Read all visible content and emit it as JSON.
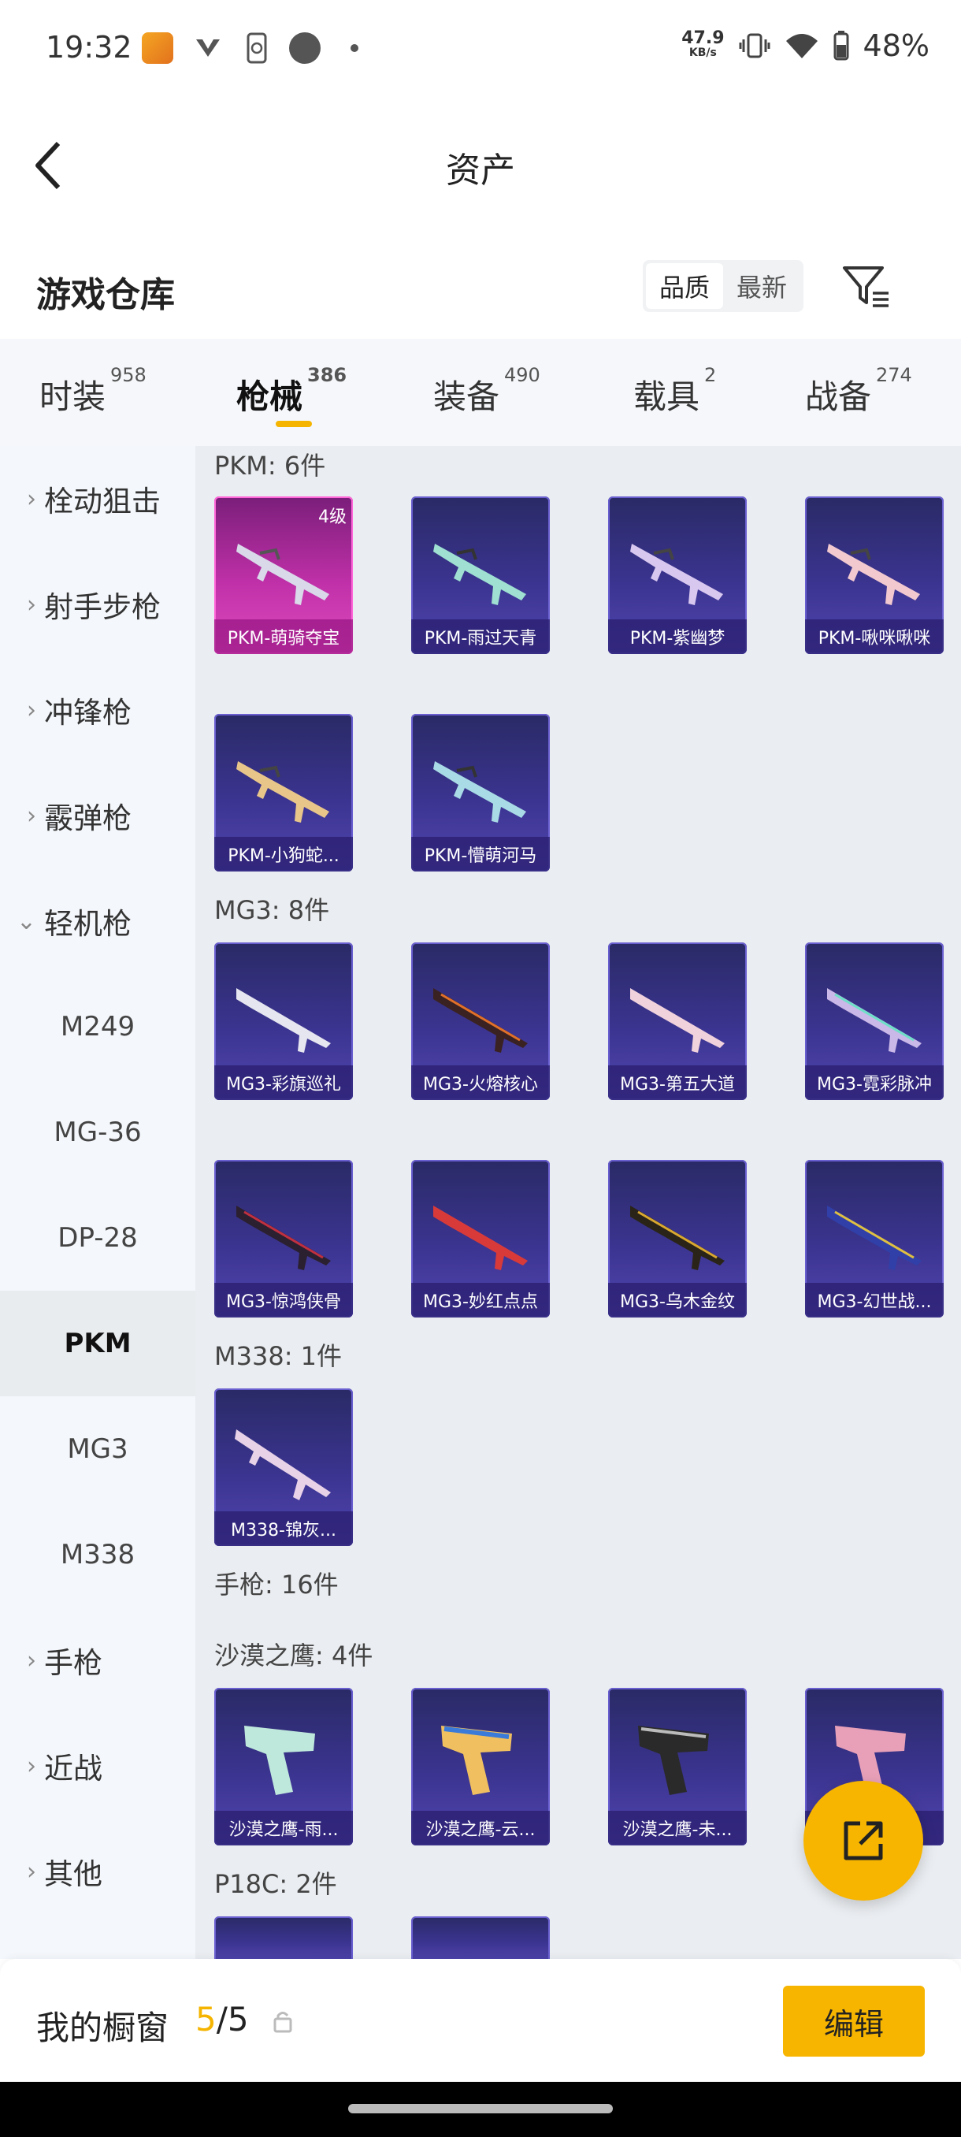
{
  "status": {
    "time": "19:32",
    "speed_value": "47.9",
    "speed_unit": "KB/s",
    "battery": "48%"
  },
  "header": {
    "title": "资产"
  },
  "section": {
    "title": "游戏仓库",
    "sort_options": [
      "品质",
      "最新"
    ],
    "sort_active": "品质"
  },
  "tabs": [
    {
      "label": "时装",
      "count": "958"
    },
    {
      "label": "枪械",
      "count": "386"
    },
    {
      "label": "装备",
      "count": "490"
    },
    {
      "label": "载具",
      "count": "2"
    },
    {
      "label": "战备",
      "count": "274"
    }
  ],
  "sidebar": [
    {
      "label": "栓动狙击"
    },
    {
      "label": "射手步枪"
    },
    {
      "label": "冲锋枪"
    },
    {
      "label": "霰弹枪"
    },
    {
      "label": "轻机枪"
    },
    {
      "label": "M249"
    },
    {
      "label": "MG-36"
    },
    {
      "label": "DP-28"
    },
    {
      "label": "PKM"
    },
    {
      "label": "MG3"
    },
    {
      "label": "M338"
    },
    {
      "label": "手枪"
    },
    {
      "label": "近战"
    },
    {
      "label": "其他"
    }
  ],
  "groups": {
    "pkm": "PKM: 6件",
    "mg3": "MG3: 8件",
    "m338": "M338: 1件",
    "pistol": "手枪: 16件",
    "deagle": "沙漠之鹰: 4件",
    "p18c": "P18C: 2件"
  },
  "items": {
    "pkm": [
      {
        "name": "PKM-萌骑夺宝",
        "level": "4级"
      },
      {
        "name": "PKM-雨过天青"
      },
      {
        "name": "PKM-紫幽梦"
      },
      {
        "name": "PKM-啾咪啾咪"
      },
      {
        "name": "PKM-小狗蛇..."
      },
      {
        "name": "PKM-懵萌河马"
      }
    ],
    "mg3": [
      {
        "name": "MG3-彩旗巡礼"
      },
      {
        "name": "MG3-火熔核心"
      },
      {
        "name": "MG3-第五大道"
      },
      {
        "name": "MG3-霓彩脉冲"
      },
      {
        "name": "MG3-惊鸿侠骨"
      },
      {
        "name": "MG3-妙红点点"
      },
      {
        "name": "MG3-乌木金纹"
      },
      {
        "name": "MG3-幻世战..."
      }
    ],
    "m338": [
      {
        "name": "M338-锦灰..."
      }
    ],
    "deagle": [
      {
        "name": "沙漠之鹰-雨..."
      },
      {
        "name": "沙漠之鹰-云..."
      },
      {
        "name": "沙漠之鹰-未..."
      },
      {
        "name": ""
      }
    ]
  },
  "showcase": {
    "label": "我的橱窗",
    "current": "5",
    "total": "/5",
    "edit_label": "编辑"
  },
  "colors": {
    "accent": "#f7b500",
    "card_purple": "#3b3490",
    "card_pink": "#c030a8"
  }
}
